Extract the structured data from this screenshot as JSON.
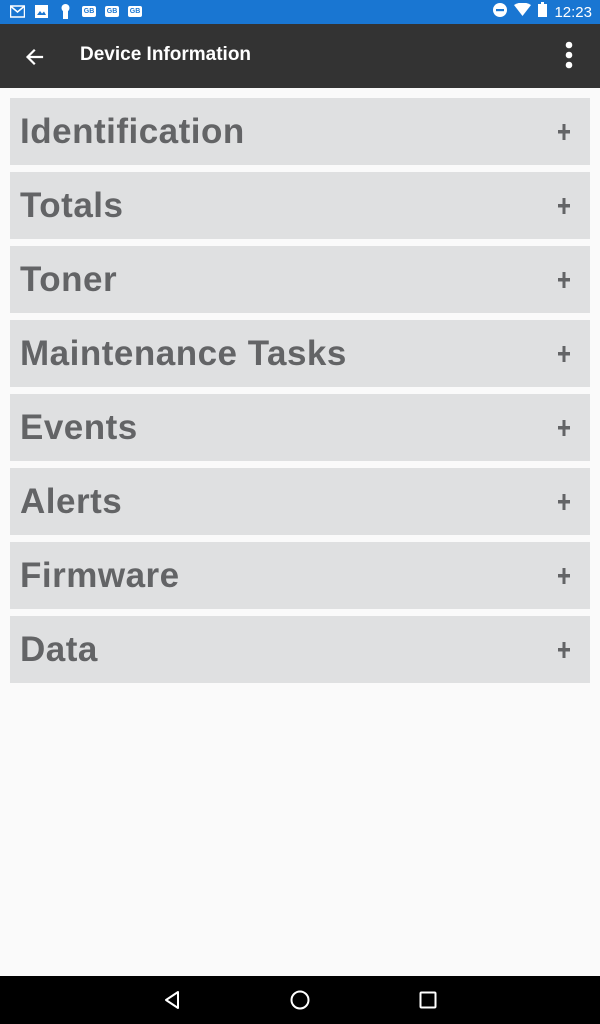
{
  "status_bar": {
    "left_icons": [
      "gmail-icon",
      "image-icon",
      "keyhole-icon",
      "gb-icon",
      "gb-icon",
      "gb-icon"
    ],
    "gb_label": "GB",
    "right_icons": [
      "do-not-disturb-icon",
      "wifi-icon",
      "battery-icon"
    ],
    "time": "12:23"
  },
  "app_bar": {
    "title": "Device Information",
    "back_icon": "arrow-left-icon",
    "menu_icon": "more-vert-icon"
  },
  "sections": [
    {
      "label": "Identification",
      "expand_icon": "plus-icon"
    },
    {
      "label": "Totals",
      "expand_icon": "plus-icon"
    },
    {
      "label": "Toner",
      "expand_icon": "plus-icon"
    },
    {
      "label": "Maintenance Tasks",
      "expand_icon": "plus-icon"
    },
    {
      "label": "Events",
      "expand_icon": "plus-icon"
    },
    {
      "label": "Alerts",
      "expand_icon": "plus-icon"
    },
    {
      "label": "Firmware",
      "expand_icon": "plus-icon"
    },
    {
      "label": "Data",
      "expand_icon": "plus-icon"
    }
  ],
  "nav_bar": {
    "buttons": [
      "back-triangle-icon",
      "home-circle-icon",
      "recents-square-icon"
    ]
  },
  "colors": {
    "status_bar": "#1976d2",
    "app_bar": "#333333",
    "section_bg": "#dfe0e1",
    "section_text": "#636466",
    "page_bg": "#fafafa"
  }
}
